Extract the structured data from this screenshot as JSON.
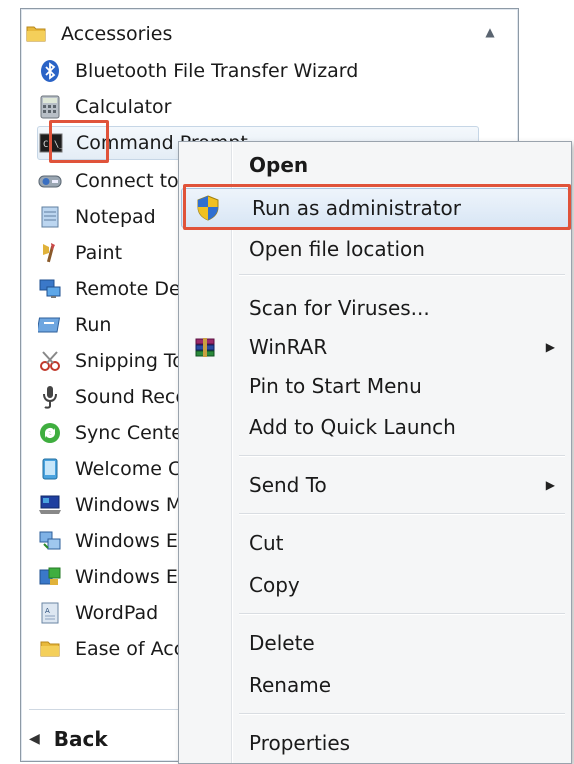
{
  "programs": {
    "folder": "Accessories",
    "items": [
      {
        "label": "Bluetooth File Transfer Wizard",
        "icon": "bluetooth-icon"
      },
      {
        "label": "Calculator",
        "icon": "calculator-icon"
      },
      {
        "label": "Command Prompt",
        "icon": "command-prompt-icon"
      },
      {
        "label": "Connect to a Network Projector",
        "icon": "projector-icon"
      },
      {
        "label": "Notepad",
        "icon": "notepad-icon"
      },
      {
        "label": "Paint",
        "icon": "paint-icon"
      },
      {
        "label": "Remote Desktop Connection",
        "icon": "remote-desktop-icon"
      },
      {
        "label": "Run",
        "icon": "run-icon"
      },
      {
        "label": "Snipping Tool",
        "icon": "scissors-icon"
      },
      {
        "label": "Sound Recorder",
        "icon": "microphone-icon"
      },
      {
        "label": "Sync Center",
        "icon": "sync-icon"
      },
      {
        "label": "Welcome Center",
        "icon": "welcome-icon"
      },
      {
        "label": "Windows Mobility Center",
        "icon": "mobility-icon"
      },
      {
        "label": "Windows Easy Transfer",
        "icon": "easy-transfer-icon"
      },
      {
        "label": "Windows Easy Transfer Reports",
        "icon": "transfer-reports-icon"
      },
      {
        "label": "WordPad",
        "icon": "wordpad-icon"
      }
    ],
    "subfolder": "Ease of Access",
    "back_label": "Back"
  },
  "context_menu": {
    "items": [
      {
        "label": "Open",
        "default": true
      },
      {
        "label": "Run as administrator",
        "icon": "uac-shield-icon",
        "highlighted": true
      },
      {
        "label": "Open file location"
      },
      {
        "label": "Scan for Viruses..."
      },
      {
        "label": "WinRAR",
        "icon": "winrar-icon",
        "submenu": true
      },
      {
        "label": "Pin to Start Menu"
      },
      {
        "label": "Add to Quick Launch"
      },
      {
        "label": "Send To",
        "submenu": true
      },
      {
        "label": "Cut"
      },
      {
        "label": "Copy"
      },
      {
        "label": "Delete"
      },
      {
        "label": "Rename"
      },
      {
        "label": "Properties"
      }
    ]
  },
  "colors": {
    "highlight_border": "#e0533a",
    "menu_highlight": "#d8e6f5"
  }
}
